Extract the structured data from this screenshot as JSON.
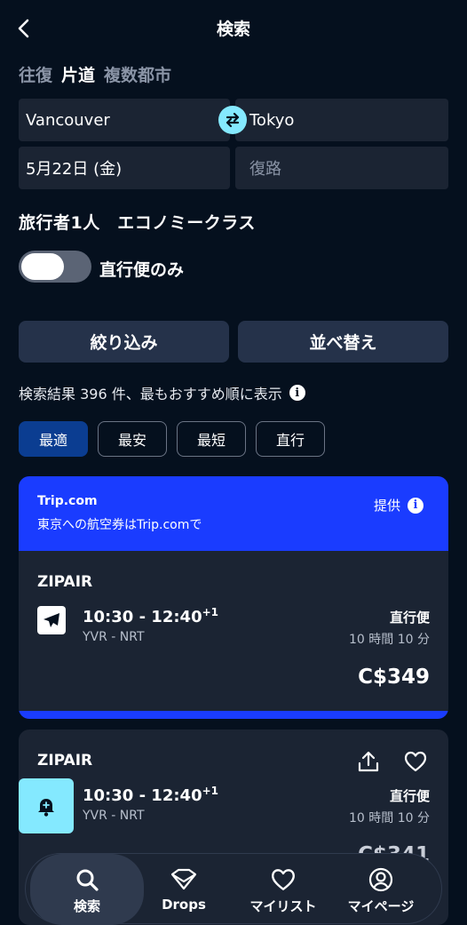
{
  "header": {
    "title": "検索"
  },
  "trip_types": [
    "往復",
    "片道",
    "複数都市"
  ],
  "trip_type_active": "片道",
  "search": {
    "origin": "Vancouver",
    "destination": "Tokyo",
    "depart_date": "5月22日 (金)",
    "return_placeholder": "復路"
  },
  "travellers": "旅行者1人　エコノミークラス",
  "direct_toggle_label": "直行便のみ",
  "buttons": {
    "filter": "絞り込み",
    "sort": "並べ替え"
  },
  "results_summary": "検索結果 396 件、最もおすすめ順に表示",
  "chips": [
    "最適",
    "最安",
    "最短",
    "直行"
  ],
  "chip_active": "最適",
  "promo": {
    "brand": "Trip.com",
    "subtitle": "東京への航空券はTrip.comで",
    "provided": "提供"
  },
  "results": [
    {
      "airline": "ZIPAIR",
      "time": "10:30 - 12:40",
      "day_offset": "+1",
      "route": "YVR - NRT",
      "stops": "直行便",
      "duration": "10 時間 10 分",
      "price": "C$349"
    },
    {
      "airline": "ZIPAIR",
      "time": "10:30 - 12:40",
      "day_offset": "+1",
      "route": "YVR - NRT",
      "stops": "直行便",
      "duration": "10 時間 10 分",
      "price": "C$341"
    }
  ],
  "nav": [
    {
      "label": "検索",
      "icon": "search-icon"
    },
    {
      "label": "Drops",
      "icon": "drops-icon"
    },
    {
      "label": "マイリスト",
      "icon": "heart-icon"
    },
    {
      "label": "マイページ",
      "icon": "profile-icon"
    }
  ],
  "colors": {
    "background": "#05101e",
    "accent": "#84e9ff",
    "promo": "#1a3cff",
    "card": "#1b2433",
    "chip_active": "#0b3d91"
  }
}
